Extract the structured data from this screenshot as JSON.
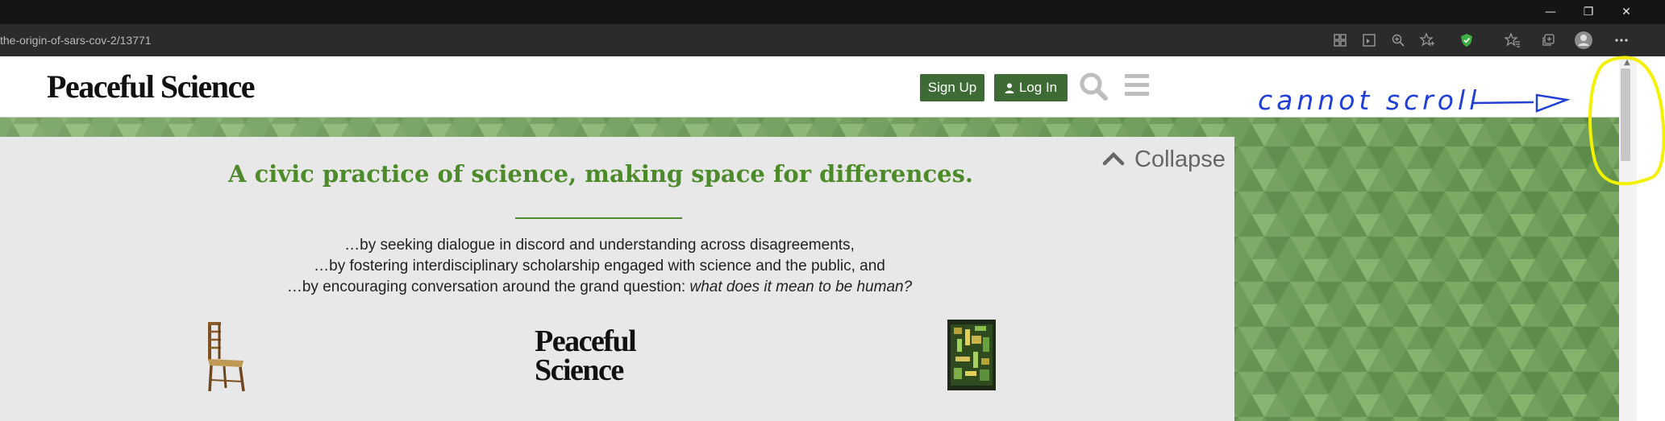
{
  "window": {
    "minimize_glyph": "—",
    "restore_glyph": "❐",
    "close_glyph": "✕"
  },
  "address_bar": {
    "url": "the-origin-of-sars-cov-2/13771",
    "toolbar_icons": [
      "grid-icon",
      "reader-view-icon",
      "zoom-icon",
      "favorite-add-icon",
      "shield-extension-icon",
      "favorites-icon",
      "collections-icon",
      "profile-icon",
      "more-icon"
    ]
  },
  "header": {
    "logo": "Peaceful Science",
    "signup_label": "Sign Up",
    "login_label": "Log In",
    "icons": [
      "search-icon",
      "hamburger-menu-icon"
    ]
  },
  "banner": {
    "tagline": "A civic practice of science, making space for differences.",
    "lines": [
      "…by seeking dialogue in discord and understanding across disagreements,",
      "…by fostering interdisciplinary scholarship engaged with science and the public, and",
      "…by encouraging conversation around the grand question: "
    ],
    "question": "what does it mean to be human?",
    "collapse_label": "Collapse",
    "mini_logo_line1": "Peaceful",
    "mini_logo_line2": "Science"
  },
  "annotation": {
    "text": "cannot scroll",
    "color": "#1f3fd6",
    "highlight_color": "#f2f200"
  },
  "colors": {
    "accent_green": "#4d8a2a",
    "button_green": "#3e6a35"
  }
}
